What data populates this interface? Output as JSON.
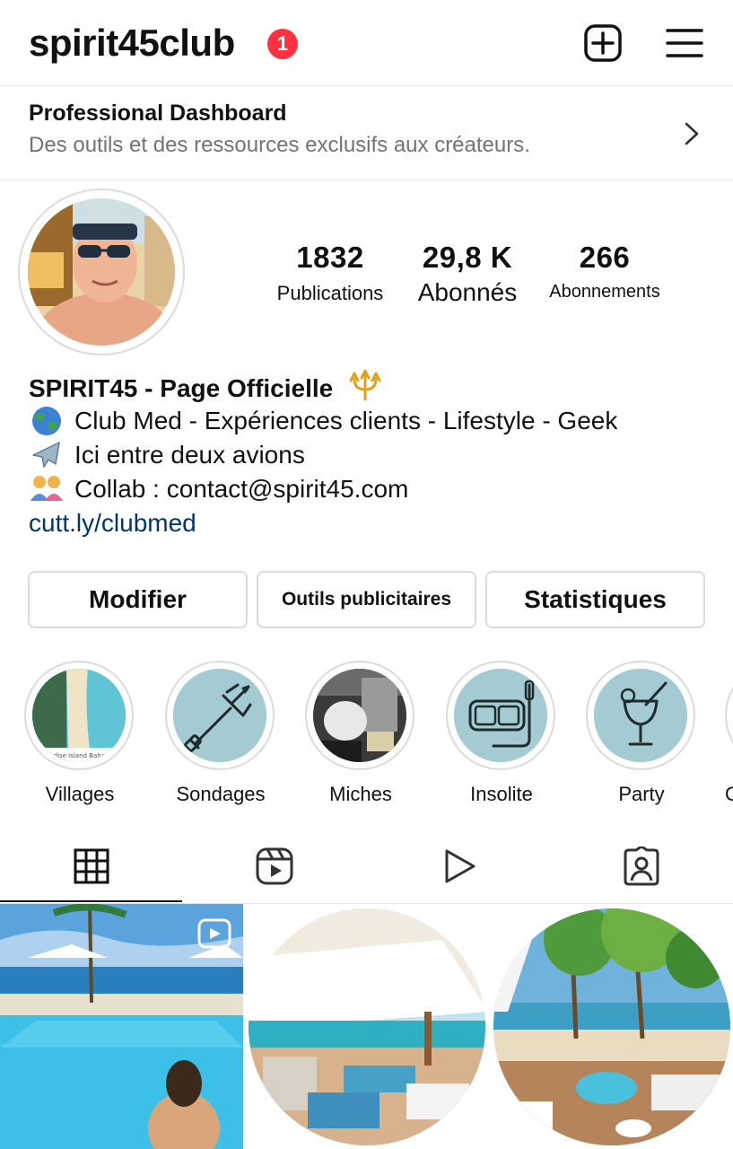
{
  "header": {
    "username": "spirit45club",
    "notification_count": "1",
    "add_icon": "plus-square-icon",
    "menu_icon": "hamburger-menu-icon"
  },
  "dashboard": {
    "title": "Professional Dashboard",
    "subtitle": "Des outils et des ressources exclusifs aux créateurs."
  },
  "profile": {
    "stats": [
      {
        "value": "1832",
        "label": "Publications"
      },
      {
        "value": "29,8 K",
        "label": "Abonnés"
      },
      {
        "value": "266",
        "label": "Abonnements"
      }
    ],
    "bio": {
      "name": "SPIRIT45 - Page Officielle",
      "lines": [
        {
          "icon": "globe-icon",
          "text": "Club Med - Expériences clients - Lifestyle - Geek"
        },
        {
          "icon": "airplane-icon",
          "text": "Ici entre deux avions"
        },
        {
          "icon": "family-icon",
          "text": "Collab : contact@spirit45.com"
        }
      ],
      "link": "cutt.ly/clubmed"
    }
  },
  "actions": {
    "edit": "Modifier",
    "ads": "Outils publicitaires",
    "stats": "Statistiques"
  },
  "highlights": [
    {
      "label": "Villages",
      "caption": "Paradise Island Bahamas"
    },
    {
      "label": "Sondages"
    },
    {
      "label": "Miches"
    },
    {
      "label": "Insolite"
    },
    {
      "label": "Party"
    },
    {
      "label": "C"
    }
  ],
  "tabs": [
    "grid-icon",
    "reels-icon",
    "video-play-icon",
    "tagged-icon"
  ],
  "colors": {
    "badge": "#ff3040",
    "link": "#00376b",
    "highlight_bg": "#a4cbd2",
    "secondary_text": "#737373",
    "border": "#dbdbdb"
  }
}
